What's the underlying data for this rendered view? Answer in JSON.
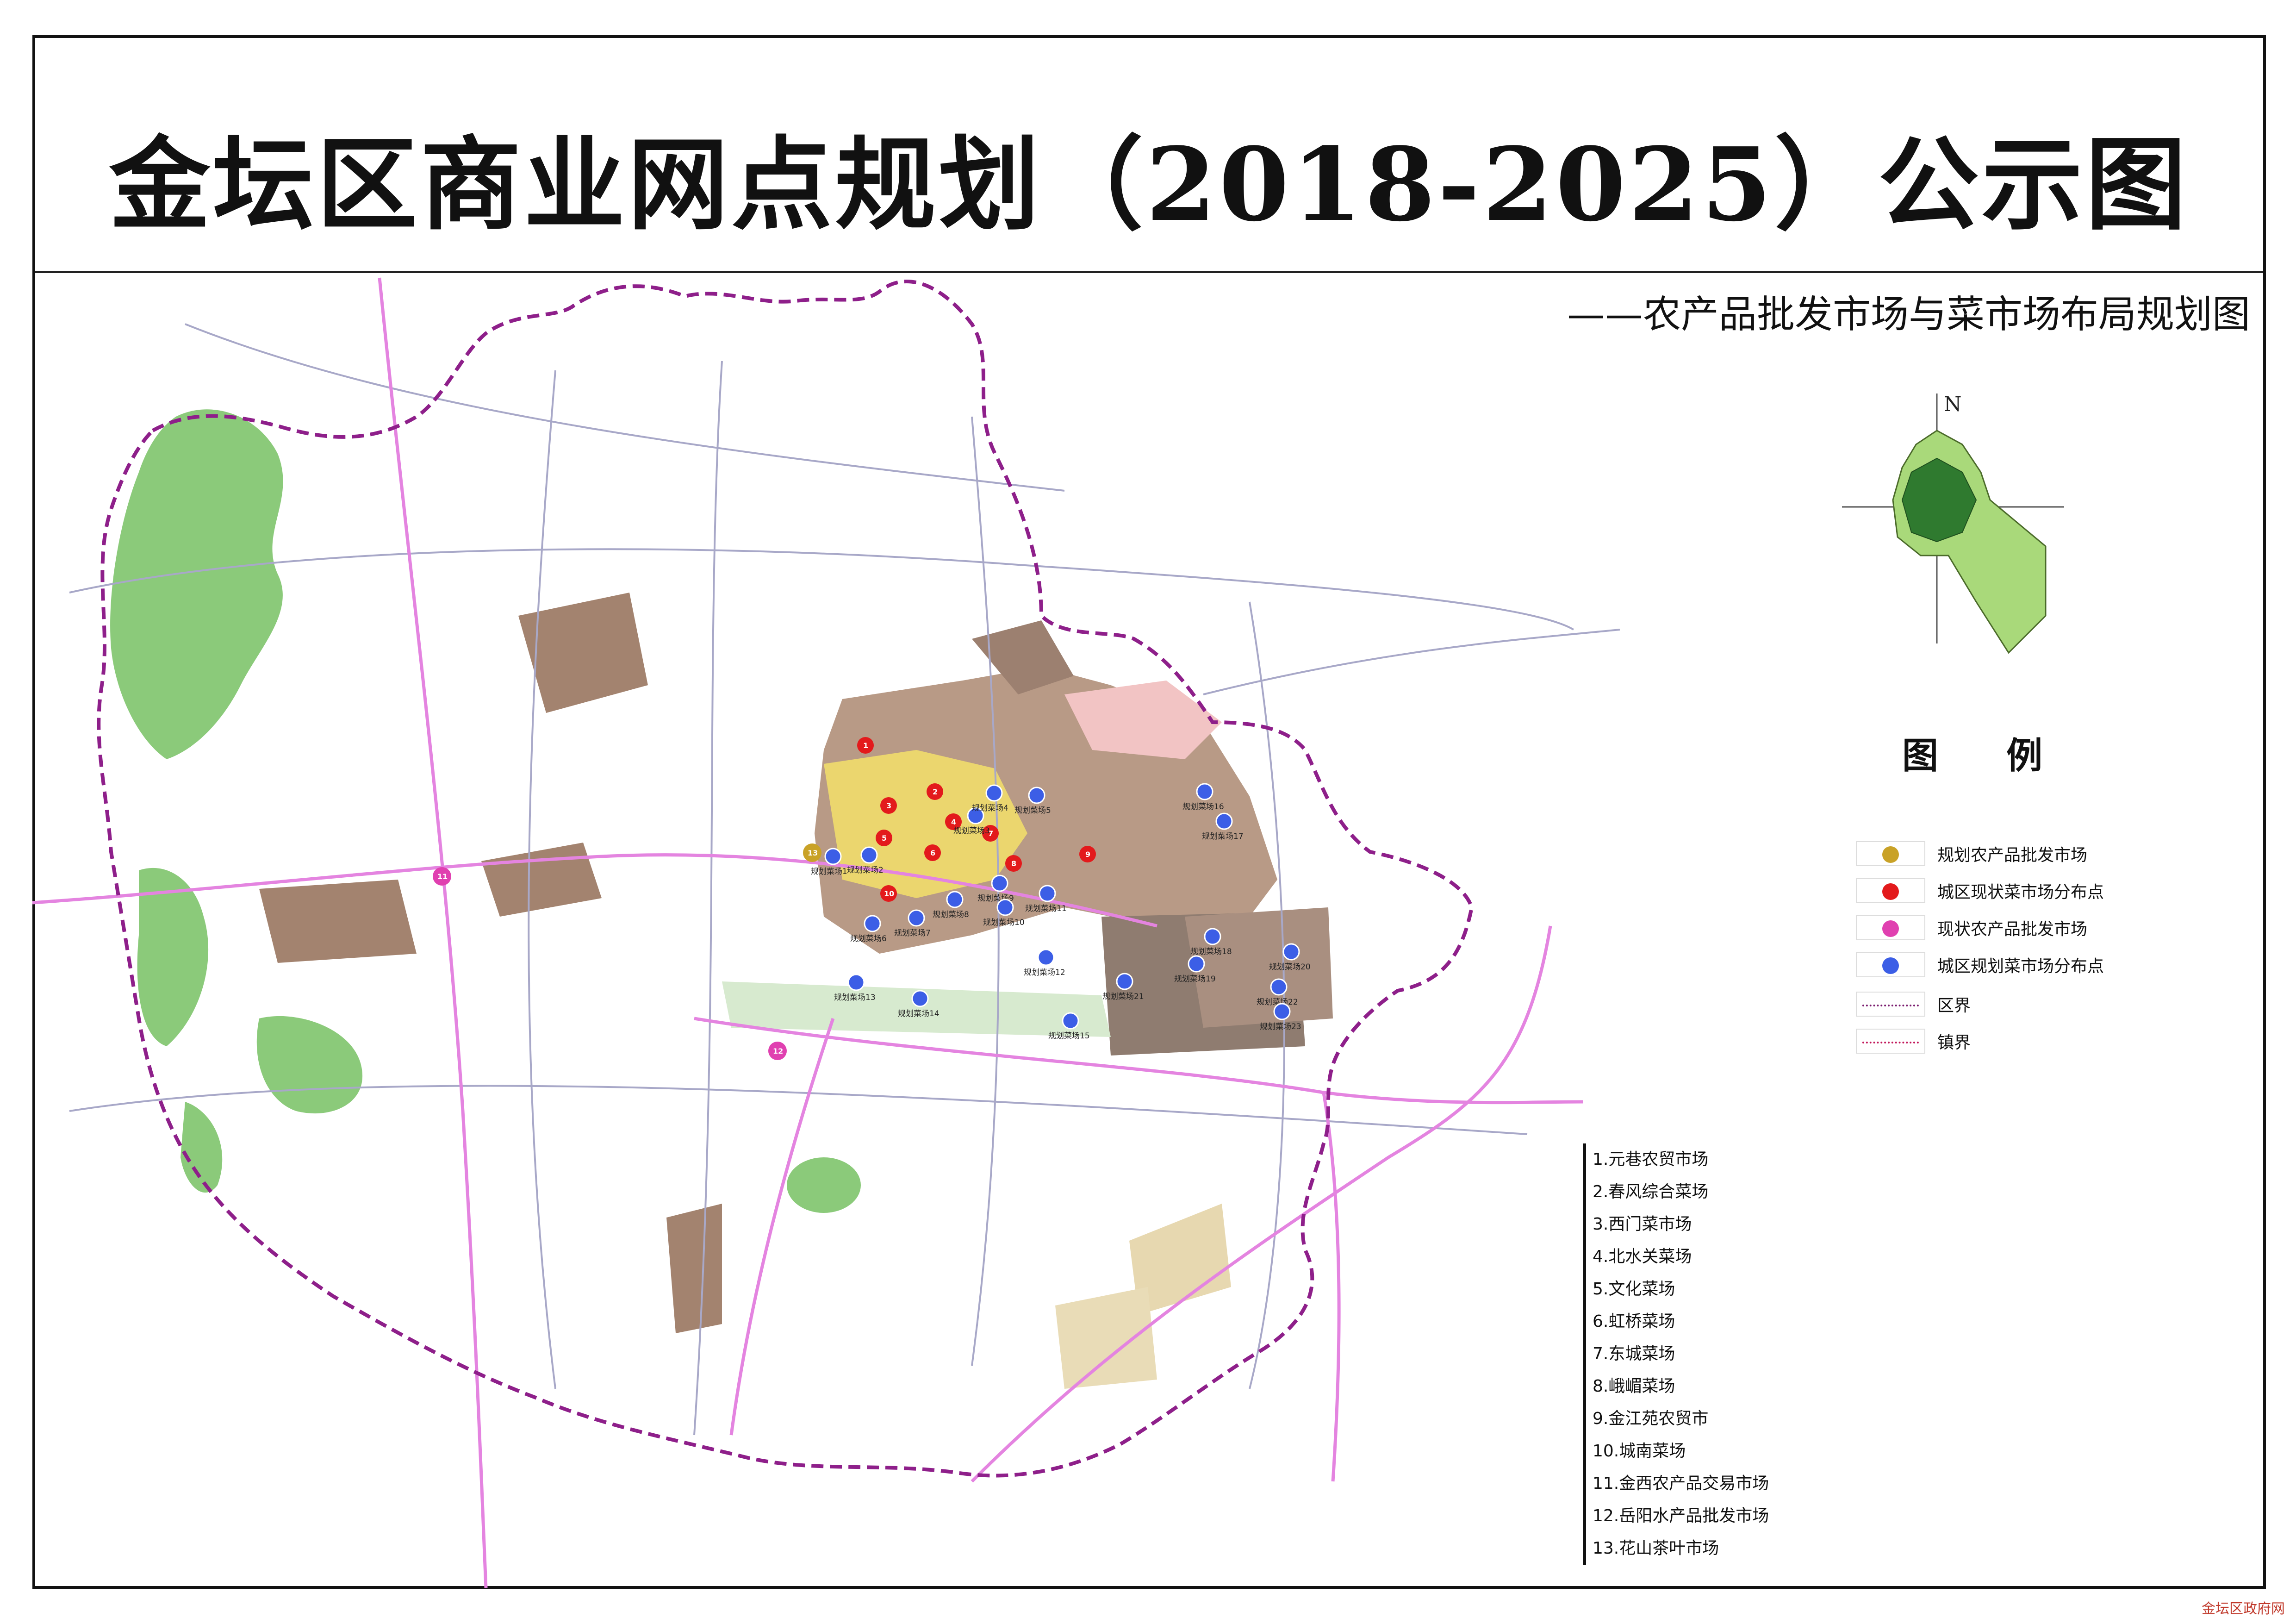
{
  "title": "金坛区商业网点规划（2018-2025）公示图",
  "subtitle": "——农产品批发市场与菜市场布局规划图",
  "compass": {
    "label": "N"
  },
  "legend": {
    "title": "图  例",
    "items": [
      {
        "label": "规划农产品批发市场",
        "symbol": "dot",
        "color": "#c9a227"
      },
      {
        "label": "城区现状菜市场分布点",
        "symbol": "dot",
        "color": "#e31a1c"
      },
      {
        "label": "现状农产品批发市场",
        "symbol": "dot",
        "color": "#e040b0"
      },
      {
        "label": "城区规划菜市场分布点",
        "symbol": "dot",
        "color": "#3c5ee6"
      },
      {
        "label": "区界",
        "symbol": "line",
        "color": "#7a1b6e"
      },
      {
        "label": "镇界",
        "symbol": "line",
        "color": "#c2185b"
      }
    ]
  },
  "market_list": [
    "1.元巷农贸市场",
    "2.春风综合菜场",
    "3.西门菜市场",
    "4.北水关菜场",
    "5.文化菜场",
    "6.虹桥菜场",
    "7.东城菜场",
    "8.峨嵋菜场",
    "9.金江苑农贸市",
    "10.城南菜场",
    "11.金西农产品交易市场",
    "12.岳阳水产品批发市场",
    "13.花山茶叶市场"
  ],
  "planned_markets": [
    "规划菜场1",
    "规划菜场2",
    "规划菜场3",
    "规划菜场4",
    "规划菜场5",
    "规划菜场6",
    "规划菜场7",
    "规划菜场8",
    "规划菜场9",
    "规划菜场10",
    "规划菜场11",
    "规划菜场12",
    "规划菜场13",
    "规划菜场14",
    "规划菜场15",
    "规划菜场16",
    "规划菜场17",
    "规划菜场18",
    "规划菜场19",
    "规划菜场20",
    "规划菜场21",
    "规划菜场22",
    "规划菜场23"
  ],
  "existing_market_numbers": [
    "1",
    "2",
    "3",
    "4",
    "5",
    "6",
    "7",
    "8",
    "9",
    "10"
  ],
  "wholesale_existing_numbers": [
    "11",
    "12"
  ],
  "wholesale_planned_numbers": [
    "13"
  ],
  "watermark": "金坛区政府网"
}
